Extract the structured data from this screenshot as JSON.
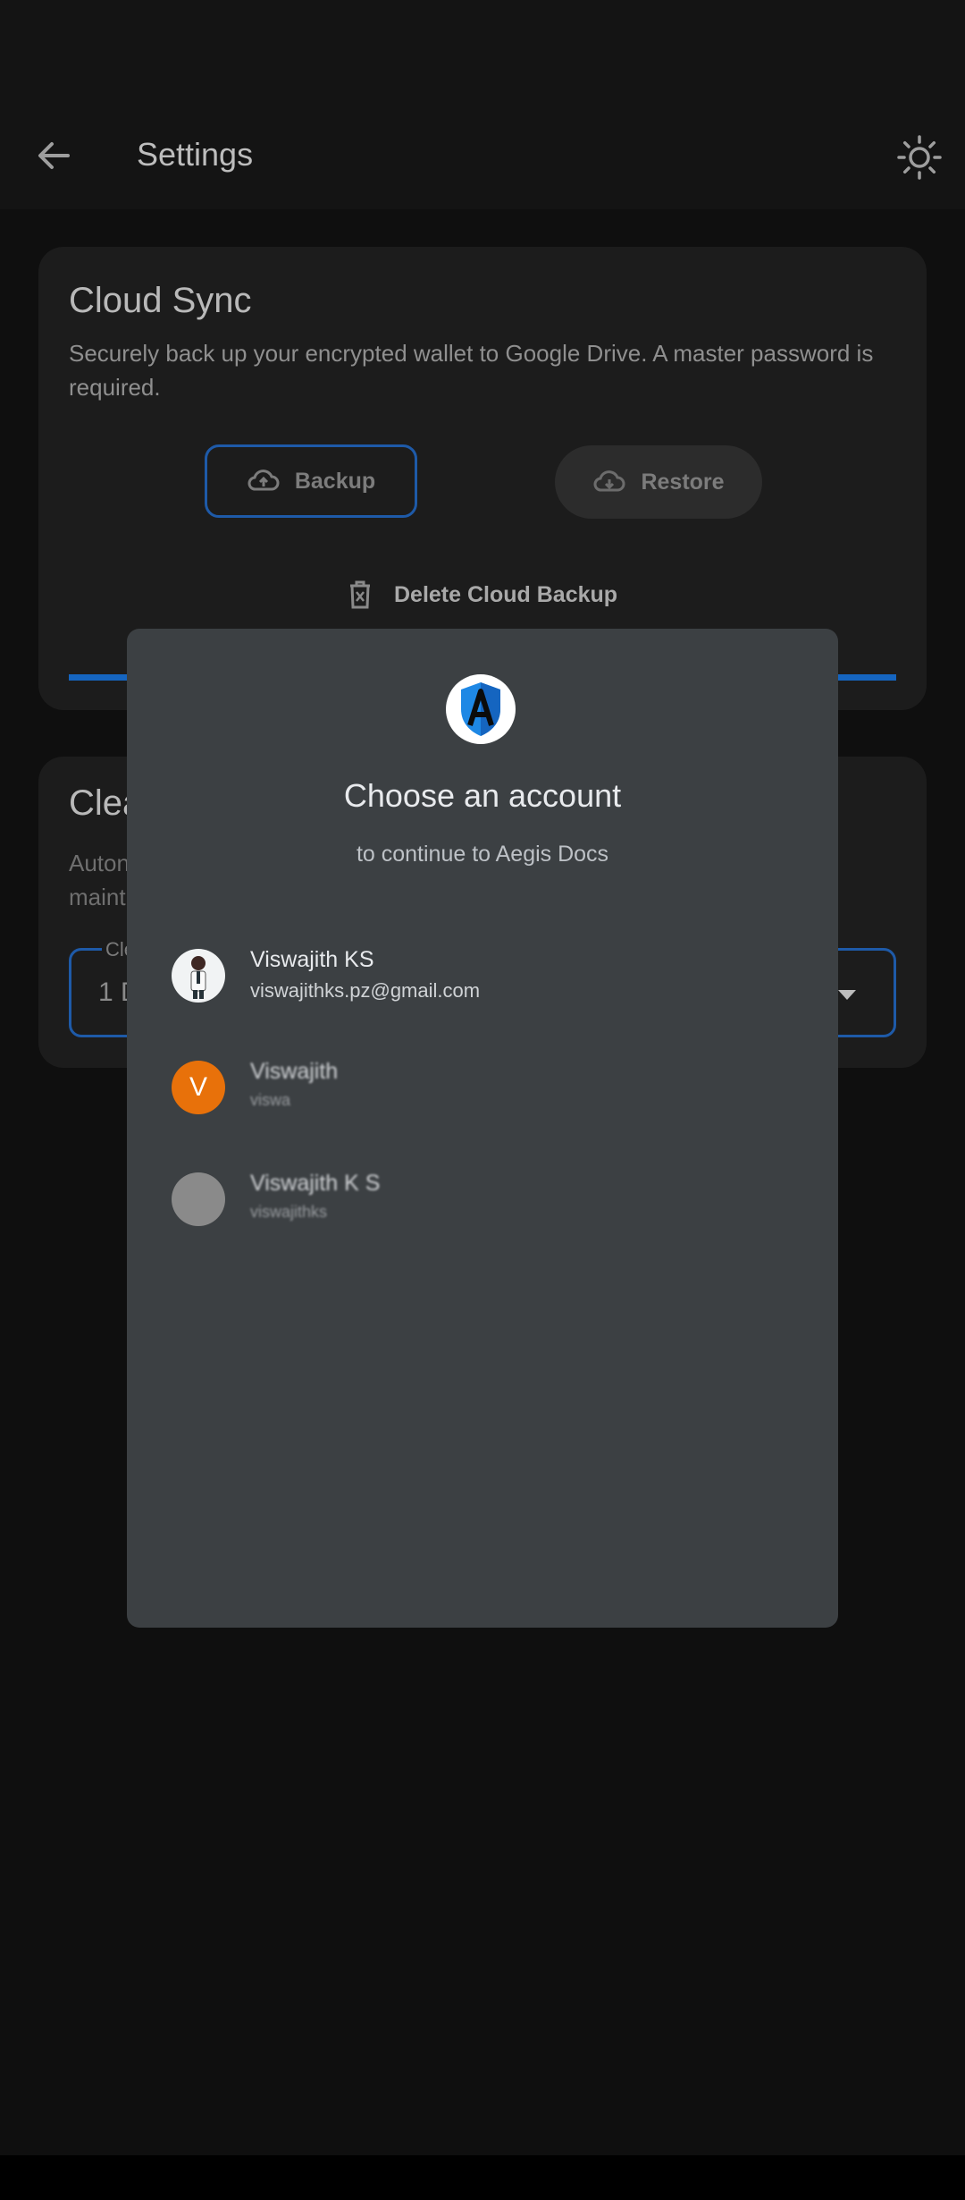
{
  "appbar": {
    "title": "Settings",
    "back_icon": "arrow-back-icon",
    "theme_icon": "brightness-icon"
  },
  "cloud_sync": {
    "title": "Cloud Sync",
    "description": "Securely back up your encrypted wallet to Google Drive. A master password is required.",
    "backup_label": "Backup",
    "restore_label": "Restore",
    "delete_label": "Delete Cloud Backup",
    "progress": 1.0
  },
  "clear_card": {
    "title": "Clea",
    "description_line1": "Auton",
    "description_line2": "maint",
    "select_label": "Cle",
    "select_value": "1 D"
  },
  "dialog": {
    "title": "Choose an account",
    "subtitle": "to continue to Aegis Docs",
    "logo_icon": "aegis-shield-logo",
    "accounts": [
      {
        "name": "Viswajith KS",
        "email": "viswajithks.pz@gmail.com",
        "avatar": ""
      },
      {
        "name": "Viswajith",
        "email": "viswa",
        "avatar": "V"
      },
      {
        "name": "Viswajith K S",
        "email": "viswajithks",
        "avatar": ""
      }
    ]
  },
  "colors": {
    "accent": "#1e5aa8",
    "dialog_bg": "#3c4043",
    "avatar_orange": "#e8710a"
  }
}
